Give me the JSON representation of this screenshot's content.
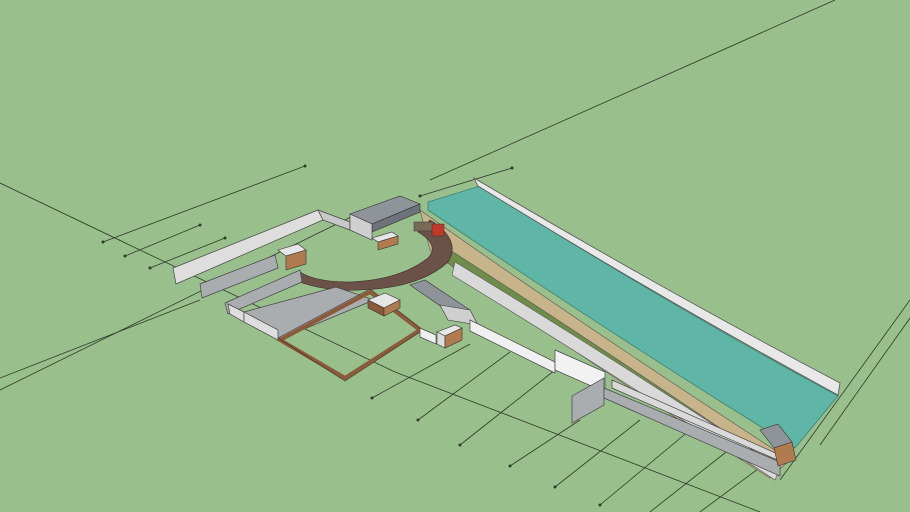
{
  "scene": {
    "kind": "3D site model viewport",
    "background_color": "#99bf8c",
    "guide_line_color": "#2f3a2a",
    "water_color": "#5fb6a6",
    "ground_path_color": "#6b5147",
    "wall_color": "#dedede",
    "wall_shadow_color": "#a9adb0",
    "fence_color": "#8a5a3a",
    "embankment_color": "#c8b48a",
    "berm_color": "#6f8d4a",
    "vehicle_color": "#c0392b"
  }
}
